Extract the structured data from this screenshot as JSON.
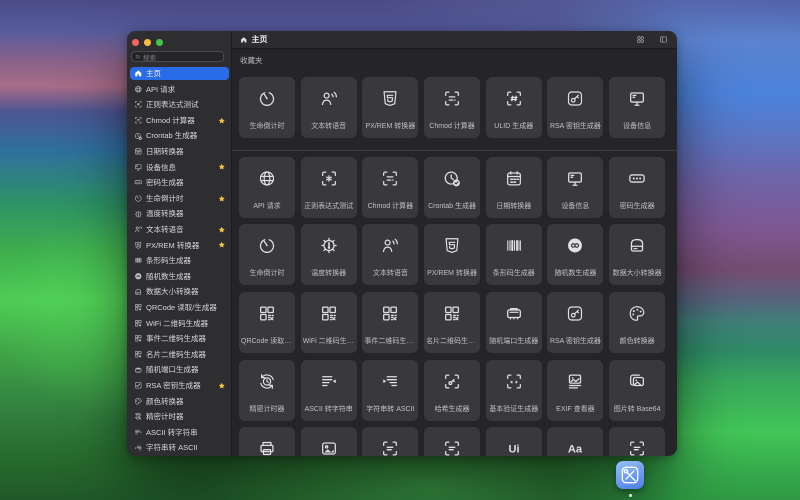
{
  "window": {
    "titlebar": {
      "traffic_lights": [
        "close",
        "minimize",
        "zoom"
      ],
      "right_icons": [
        "grid-view-icon",
        "toggle-sidebar-icon"
      ]
    },
    "header": {
      "title": "主页",
      "icon": "home"
    }
  },
  "sidebar": {
    "search": {
      "placeholder": "搜索",
      "icon": "search"
    },
    "items": [
      {
        "label": "主页",
        "icon": "home",
        "selected": true,
        "starred": false
      },
      {
        "label": "API 请求",
        "icon": "globe",
        "selected": false,
        "starred": false
      },
      {
        "label": "正则表达式测试",
        "icon": "regex",
        "selected": false,
        "starred": false
      },
      {
        "label": "Chmod 计算器",
        "icon": "chmod",
        "selected": false,
        "starred": true
      },
      {
        "label": "Crontab 生成器",
        "icon": "crontab",
        "selected": false,
        "starred": false
      },
      {
        "label": "日期转换器",
        "icon": "calendar",
        "selected": false,
        "starred": false
      },
      {
        "label": "设备信息",
        "icon": "monitor",
        "selected": false,
        "starred": true
      },
      {
        "label": "密码生成器",
        "icon": "password",
        "selected": false,
        "starred": false
      },
      {
        "label": "生命倒计时",
        "icon": "countdown",
        "selected": false,
        "starred": true
      },
      {
        "label": "温度转换器",
        "icon": "thermo",
        "selected": false,
        "starred": false
      },
      {
        "label": "文本转语音",
        "icon": "speech",
        "selected": false,
        "starred": true
      },
      {
        "label": "PX/REM 转换器",
        "icon": "html5",
        "selected": false,
        "starred": true
      },
      {
        "label": "条形码生成器",
        "icon": "barcode",
        "selected": false,
        "starred": false
      },
      {
        "label": "随机数生成器",
        "icon": "infinity",
        "selected": false,
        "starred": false
      },
      {
        "label": "数据大小转换器",
        "icon": "drive",
        "selected": false,
        "starred": false
      },
      {
        "label": "QRCode 读取/生成器",
        "icon": "qr",
        "selected": false,
        "starred": false
      },
      {
        "label": "WiFi 二维码生成器",
        "icon": "qr",
        "selected": false,
        "starred": false
      },
      {
        "label": "事件二维码生成器",
        "icon": "qr",
        "selected": false,
        "starred": false
      },
      {
        "label": "名片二维码生成器",
        "icon": "qr",
        "selected": false,
        "starred": false
      },
      {
        "label": "随机端口生成器",
        "icon": "port",
        "selected": false,
        "starred": false
      },
      {
        "label": "RSA 密钥生成器",
        "icon": "key",
        "selected": false,
        "starred": true
      },
      {
        "label": "颜色转换器",
        "icon": "palette",
        "selected": false,
        "starred": false
      },
      {
        "label": "精密计时器",
        "icon": "timer",
        "selected": false,
        "starred": false
      },
      {
        "label": "ASCII 转字符串",
        "icon": "ascii-left",
        "selected": false,
        "starred": false
      },
      {
        "label": "字符串转 ASCII",
        "icon": "ascii-right",
        "selected": false,
        "starred": false
      }
    ]
  },
  "main": {
    "favorites_label": "收藏夹",
    "favorites": [
      {
        "label": "生命倒计时",
        "icon": "countdown"
      },
      {
        "label": "文本转语音",
        "icon": "speech"
      },
      {
        "label": "PX/REM 转换器",
        "icon": "html5"
      },
      {
        "label": "Chmod 计算器",
        "icon": "chmod"
      },
      {
        "label": "ULID 生成器",
        "icon": "ulid"
      },
      {
        "label": "RSA 密钥生成器",
        "icon": "key"
      },
      {
        "label": "设备信息",
        "icon": "monitor"
      }
    ],
    "tools": [
      {
        "label": "API 请求",
        "icon": "globe"
      },
      {
        "label": "正则表达式测试",
        "icon": "regex"
      },
      {
        "label": "Chmod 计算器",
        "icon": "chmod"
      },
      {
        "label": "Crontab 生成器",
        "icon": "crontab"
      },
      {
        "label": "日期转换器",
        "icon": "calendar"
      },
      {
        "label": "设备信息",
        "icon": "monitor"
      },
      {
        "label": "密码生成器",
        "icon": "password"
      },
      {
        "label": "生命倒计时",
        "icon": "countdown"
      },
      {
        "label": "温度转换器",
        "icon": "thermo"
      },
      {
        "label": "文本转语音",
        "icon": "speech"
      },
      {
        "label": "PX/REM 转换器",
        "icon": "html5"
      },
      {
        "label": "条形码生成器",
        "icon": "barcode"
      },
      {
        "label": "随机数生成器",
        "icon": "infinity"
      },
      {
        "label": "数据大小转换器",
        "icon": "drive"
      },
      {
        "label": "QRCode 读取/生成器",
        "icon": "qr"
      },
      {
        "label": "WiFi 二维码生成器",
        "icon": "qr"
      },
      {
        "label": "事件二维码生成器",
        "icon": "qr"
      },
      {
        "label": "名片二维码生成器",
        "icon": "qr"
      },
      {
        "label": "随机端口生成器",
        "icon": "port"
      },
      {
        "label": "RSA 密钥生成器",
        "icon": "key"
      },
      {
        "label": "颜色转换器",
        "icon": "palette"
      },
      {
        "label": "精密计时器",
        "icon": "timer"
      },
      {
        "label": "ASCII 转字符串",
        "icon": "ascii-left"
      },
      {
        "label": "字符串转 ASCII",
        "icon": "ascii-right"
      },
      {
        "label": "哈希生成器",
        "icon": "hash-key"
      },
      {
        "label": "基本验证生成器",
        "icon": "verify"
      },
      {
        "label": "EXIF 查看器",
        "icon": "exif"
      },
      {
        "label": "图片转 Base64",
        "icon": "img64"
      },
      {
        "label": "",
        "icon": "printer"
      },
      {
        "label": "",
        "icon": "photo"
      },
      {
        "label": "",
        "icon": "frame-lines"
      },
      {
        "label": "",
        "icon": "frame-lines"
      },
      {
        "label": "",
        "icon": "text-ui"
      },
      {
        "label": "",
        "icon": "text-aa"
      },
      {
        "label": "",
        "icon": "frame-lines"
      }
    ]
  },
  "desktop": {
    "dock_app_icon": "devtoys-wrench-screwdriver",
    "app_running_dot": true
  }
}
